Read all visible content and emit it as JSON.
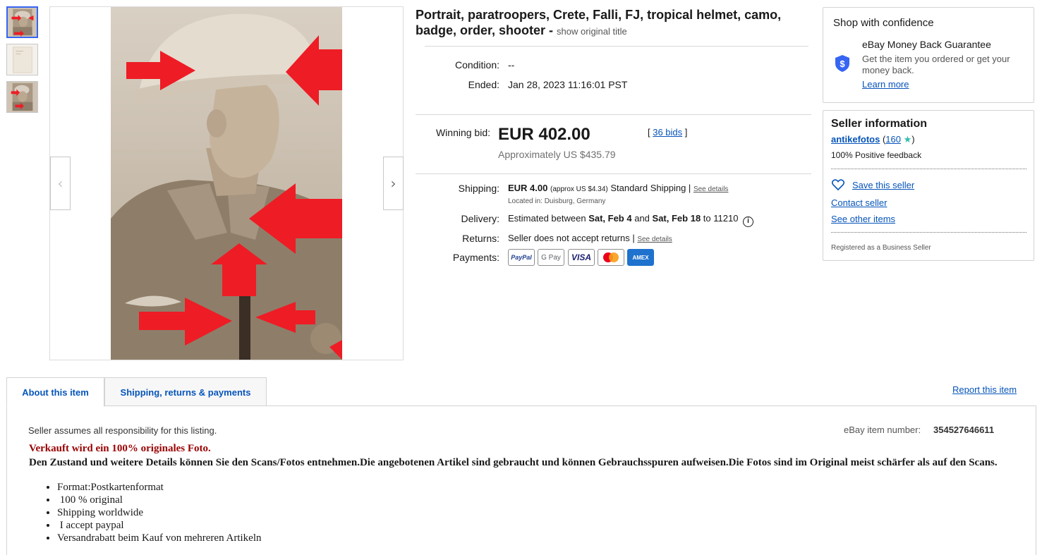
{
  "title": {
    "main": "Portrait, paratroopers, Crete, Falli, FJ, tropical helmet, camo, badge, order, shooter - ",
    "original_link": "show original title"
  },
  "details": {
    "condition_label": "Condition:",
    "condition_value": "--",
    "ended_label": "Ended:",
    "ended_value": "Jan 28, 2023 11:16:01 PST",
    "winning_bid_label": "Winning bid:",
    "winning_bid_value": "EUR 402.00",
    "approx_value": "Approximately US $435.79",
    "bids_open": "[ ",
    "bids_link": "36 bids",
    "bids_close": " ]",
    "shipping_label": "Shipping:",
    "shipping_price": "EUR 4.00",
    "shipping_approx": "(approx US $4.34)",
    "shipping_service": "Standard Shipping |",
    "shipping_see_details": "See details",
    "located": "Located in: Duisburg, Germany",
    "delivery_label": "Delivery:",
    "delivery_prefix": "Estimated between ",
    "delivery_start": "Sat, Feb 4",
    "delivery_and": " and ",
    "delivery_end": "Sat, Feb 18",
    "delivery_to": " to 11210",
    "returns_label": "Returns:",
    "returns_value": "Seller does not accept returns |",
    "returns_see_details": "See details",
    "payments_label": "Payments:",
    "payments": [
      "PayPal",
      "G Pay",
      "VISA",
      "Mastercard",
      "AMEX"
    ]
  },
  "confidence": {
    "heading": "Shop with confidence",
    "guarantee_title": "eBay Money Back Guarantee",
    "guarantee_text": "Get the item you ordered or get your money back.",
    "learn_more": "Learn more"
  },
  "seller": {
    "heading": "Seller information",
    "name": "antikefotos",
    "feedback_open": " (",
    "feedback_score": "160",
    "feedback_close": ")",
    "positive": "100% Positive feedback",
    "save": "Save this seller",
    "contact": "Contact seller",
    "other_items": "See other items",
    "registered": "Registered as a Business Seller"
  },
  "tabs": {
    "about": "About this item",
    "shipping": "Shipping, returns & payments",
    "report": "Report this item"
  },
  "description": {
    "responsibility": "Seller assumes all responsibility for this listing.",
    "item_number_label": "eBay item number:",
    "item_number": "354527646611",
    "headline": "Verkauft wird ein 100% originales Foto.",
    "body": "Den Zustand und weitere Details können Sie den Scans/Fotos entnehmen.Die angebotenen Artikel sind gebraucht und können Gebrauchsspuren aufweisen.Die Fotos sind im Original meist schärfer als auf den Scans.",
    "bullets": [
      "Format:Postkartenformat",
      " 100 % original",
      "Shipping worldwide",
      " I accept paypal",
      "Versandrabatt beim Kauf von mehreren Artikeln"
    ]
  },
  "colors": {
    "link": "#0654ba",
    "headline_red": "#990000",
    "arrow_red": "#ee1c25",
    "selected_thumb": "#3665f3"
  },
  "icons": {
    "prev": "chevron-left-icon",
    "next": "chevron-right-icon",
    "shield": "shield-dollar-icon",
    "heart": "heart-icon",
    "info": "info-icon",
    "star": "star-icon"
  }
}
